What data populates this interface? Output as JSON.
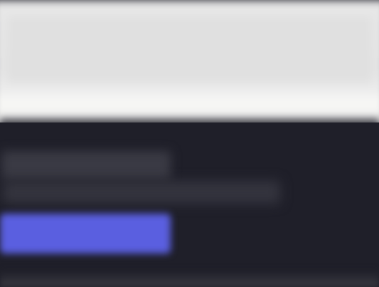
{
  "header": {
    "title": "",
    "subtitle": ""
  },
  "main": {
    "heading": "",
    "description": "",
    "primary_button_label": ""
  },
  "colors": {
    "header_background": "#e6e6e6",
    "panel_background": "#1f1f29",
    "accent": "#5a5fe0"
  }
}
